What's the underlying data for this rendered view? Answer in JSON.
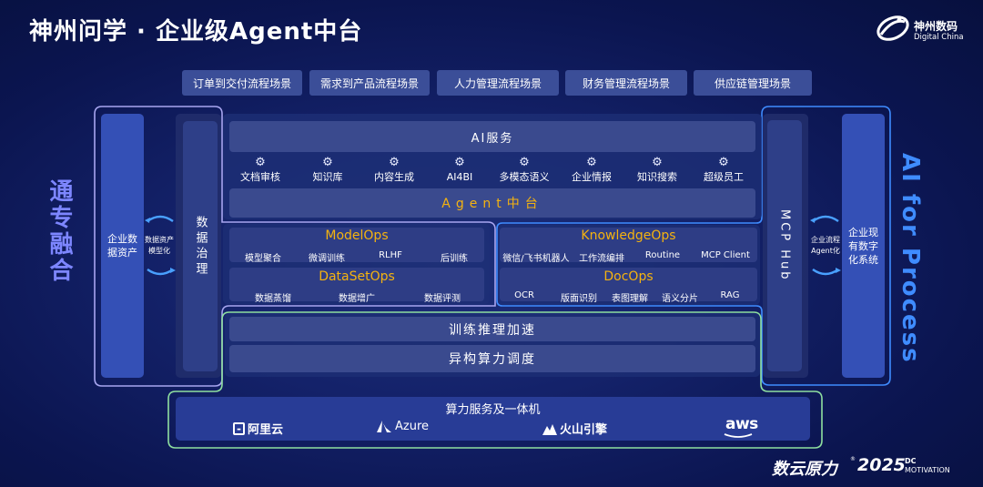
{
  "title": "神州问学 · 企业级Agent中台",
  "logo": {
    "cn": "神州数码",
    "en": "Digital China",
    "icon": "digital-china-logo-icon"
  },
  "scenarios": [
    "订单到交付流程场景",
    "需求到产品流程场景",
    "人力管理流程场景",
    "财务管理流程场景",
    "供应链管理场景"
  ],
  "left_label": "通专融合",
  "right_label": "AI for Process",
  "left": {
    "block": "企业数据资产",
    "arrow_text": "数据资产模型化",
    "governance": "数据治理"
  },
  "right": {
    "mcp": "MCP Hub",
    "arrow_text": "企业流程Agent化",
    "block": "企业现有数字化系统"
  },
  "ai_services": {
    "title": "AI服务",
    "items": [
      "文档审核",
      "知识库",
      "内容生成",
      "AI4BI",
      "多模态语义",
      "企业情报",
      "知识搜索",
      "超级员工"
    ]
  },
  "agent_platform": "Agent中台",
  "modelops": {
    "title": "ModelOps",
    "items": [
      "模型聚合",
      "微调训练",
      "RLHF",
      "后训练"
    ]
  },
  "datasetops": {
    "title": "DataSetOps",
    "items": [
      "数据蒸馏",
      "数据增广",
      "数据评测"
    ]
  },
  "knowledgeops": {
    "title": "KnowledgeOps",
    "items": [
      "微信/飞书机器人",
      "工作流编排",
      "Routine",
      "MCP Client"
    ]
  },
  "docops": {
    "title": "DocOps",
    "items": [
      "OCR",
      "版面识别",
      "表图理解",
      "语义分片",
      "RAG"
    ]
  },
  "training": "训练推理加速",
  "compute_schedule": "异构算力调度",
  "compute_service": {
    "title": "算力服务及一体机",
    "clouds": [
      "阿里云",
      "Azure",
      "火山引擎",
      "aws"
    ]
  },
  "footer": {
    "brand": "数云原力",
    "year": "2025",
    "dc": "DC",
    "motivation": "MOTIVATION"
  },
  "colors": {
    "accent_yellow": "#f5b30f",
    "left_label": "#7d86ff",
    "right_label": "#3f8cff",
    "frame_left": "#a8a6f0",
    "frame_right": "#3f8cff",
    "frame_bottom": "#8fe0a0"
  }
}
